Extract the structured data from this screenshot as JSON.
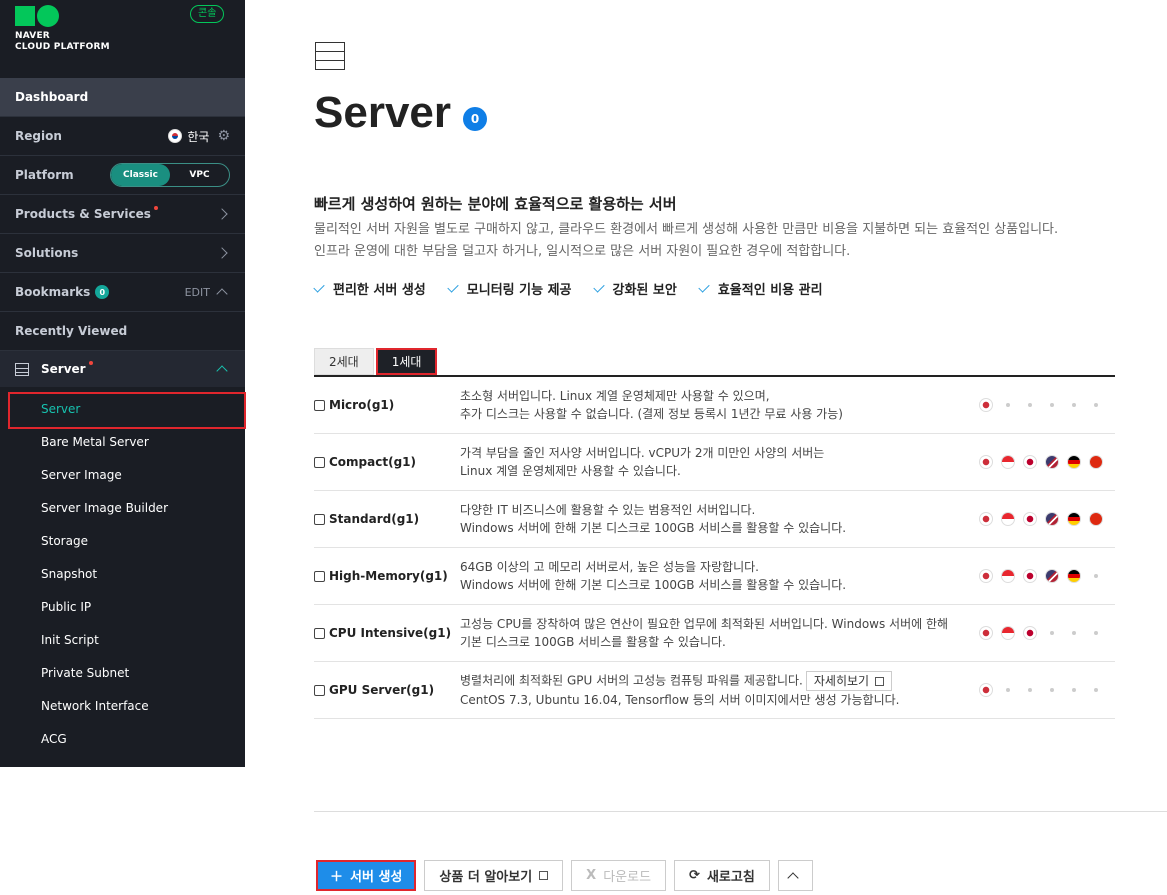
{
  "brand": {
    "line1": "NAVER",
    "line2": "CLOUD PLATFORM",
    "console_label": "콘솔"
  },
  "sidebar": {
    "dashboard": "Dashboard",
    "region_label": "Region",
    "region_value": "한국",
    "platform_label": "Platform",
    "platform_options": [
      "Classic",
      "VPC"
    ],
    "products_label": "Products & Services",
    "solutions_label": "Solutions",
    "bookmarks_label": "Bookmarks",
    "bookmarks_count": "0",
    "edit_label": "EDIT",
    "recently_viewed": "Recently Viewed",
    "server_label": "Server",
    "items": [
      "Server",
      "Bare Metal Server",
      "Server Image",
      "Server Image Builder",
      "Storage",
      "Snapshot",
      "Public IP",
      "Init Script",
      "Private Subnet",
      "Network Interface",
      "ACG"
    ]
  },
  "main": {
    "title": "Server",
    "count": "0",
    "subtitle": "빠르게 생성하여 원하는 분야에 효율적으로 활용하는 서버",
    "desc1": "물리적인 서버 자원을 별도로 구매하지 않고, 클라우드 환경에서 빠르게 생성해 사용한 만큼만 비용을 지불하면 되는 효율적인 상품입니다.",
    "desc2": "인프라 운영에 대한 부담을 덜고자 하거나, 일시적으로 많은 서버 자원이 필요한 경우에 적합합니다.",
    "features": [
      "편리한 서버 생성",
      "모니터링 기능 제공",
      "강화된 보안",
      "효율적인 비용 관리"
    ],
    "tabs": [
      "2세대",
      "1세대"
    ],
    "rows": [
      {
        "name": "Micro(g1)",
        "line1": "초소형 서버입니다. Linux 계열 운영체제만 사용할 수 있으며,",
        "line2": "추가 디스크는 사용할 수 없습니다. (결제 정보 등록시 1년간 무료 사용 가능)"
      },
      {
        "name": "Compact(g1)",
        "line1": "가격 부담을 줄인 저사양 서버입니다. vCPU가 2개 미만인 사양의 서버는",
        "line2": "Linux 계열 운영체제만 사용할 수 있습니다."
      },
      {
        "name": "Standard(g1)",
        "line1": "다양한 IT 비즈니스에 활용할 수 있는 범용적인 서버입니다.",
        "line2": "Windows 서버에 한해 기본 디스크로 100GB 서비스를 활용할 수 있습니다."
      },
      {
        "name": "High-Memory(g1)",
        "line1": "64GB 이상의 고 메모리 서버로서, 높은 성능을 자랑합니다.",
        "line2": "Windows 서버에 한해 기본 디스크로 100GB 서비스를 활용할 수 있습니다."
      },
      {
        "name": "CPU Intensive(g1)",
        "line1": "고성능 CPU를 장착하여 많은 연산이 필요한 업무에 최적화된 서버입니다. Windows 서버에 한해",
        "line2": "기본 디스크로 100GB 서비스를 활용할 수 있습니다."
      },
      {
        "name": "GPU Server(g1)",
        "line1": "병렬처리에 최적화된 GPU 서버의 고성능 컴퓨팅 파워를 제공합니다.",
        "line2": "CentOS 7.3, Ubuntu 16.04, Tensorflow 등의 서버 이미지에서만 생성 가능합니다.",
        "detail": "자세히보기"
      }
    ],
    "region_flags": [
      "KR",
      "SG",
      "JP",
      "US",
      "DE",
      "HK"
    ],
    "region_availability": [
      [
        1,
        0,
        0,
        0,
        0,
        0
      ],
      [
        1,
        1,
        1,
        1,
        1,
        1
      ],
      [
        1,
        1,
        1,
        1,
        1,
        1
      ],
      [
        1,
        1,
        1,
        1,
        1,
        0
      ],
      [
        1,
        1,
        1,
        0,
        0,
        0
      ],
      [
        1,
        0,
        0,
        0,
        0,
        0
      ]
    ],
    "flag_colors": {
      "KR": "#cd2e3a",
      "SG": "#e8272f",
      "JP": "#bc002d",
      "US": "#3c3b6e",
      "DE": "#000000",
      "HK": "#de2910"
    }
  },
  "buttons": {
    "create": "서버 생성",
    "learn_more": "상품 더 알아보기",
    "download": "다운로드",
    "refresh": "새로고침"
  }
}
